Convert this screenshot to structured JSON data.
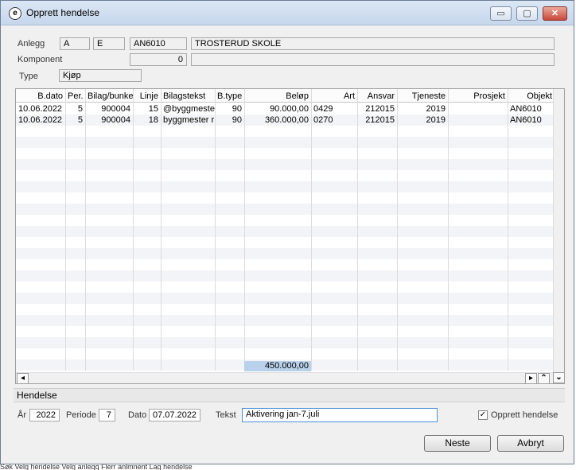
{
  "window": {
    "title": "Opprett hendelse",
    "minimize_glyph": "▭",
    "maximize_glyph": "▢",
    "close_glyph": "✕"
  },
  "header": {
    "anlegg_label": "Anlegg",
    "anlegg_code1": "A",
    "anlegg_code2": "E",
    "anlegg_id": "AN6010",
    "anlegg_name": "TROSTERUD SKOLE",
    "komponent_label": "Komponent",
    "komponent_value": "0",
    "komponent_name": "",
    "type_label": "Type",
    "type_value": "Kjøp"
  },
  "table": {
    "columns": [
      "B.dato",
      "Per.",
      "Bilag/bunke",
      "Linje",
      "Bilagstekst",
      "B.type",
      "Beløp",
      "Art",
      "Ansvar",
      "Tjeneste",
      "Prosjekt",
      "Objekt"
    ],
    "rows": [
      [
        "10.06.2022",
        "5",
        "900004",
        "15",
        "@byggmeste",
        "90",
        "90.000,00",
        "0429",
        "212015",
        "2019",
        "",
        "AN6010"
      ],
      [
        "10.06.2022",
        "5",
        "900004",
        "18",
        "byggmester r",
        "90",
        "360.000,00",
        "0270",
        "212015",
        "2019",
        "",
        "AN6010"
      ]
    ],
    "sum": "450.000,00"
  },
  "hendelse": {
    "section_label": "Hendelse",
    "ar_label": "År",
    "ar_value": "2022",
    "periode_label": "Periode",
    "periode_value": "7",
    "dato_label": "Dato",
    "dato_value": "07.07.2022",
    "tekst_label": "Tekst",
    "tekst_value": "Aktivering jan-7.juli",
    "checkbox_label": "Opprett hendelse",
    "checkbox_checked": true
  },
  "buttons": {
    "next": "Neste",
    "cancel": "Avbryt"
  },
  "taskbar": {
    "text": "Søk    Velg hendelse    Velg anlegg    Flerr anlmnent    Lag hendelse"
  }
}
